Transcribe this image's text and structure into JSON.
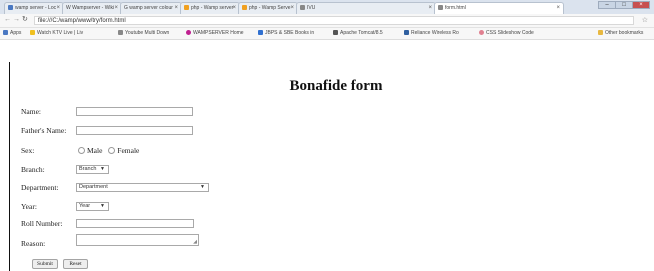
{
  "browser": {
    "tabs": [
      {
        "label": "wamp server - Loc",
        "color": "#4a78c2"
      },
      {
        "label": "W  Wampserver - Wiki",
        "color": "#555555"
      },
      {
        "label": "G  wamp server colour",
        "color": "#4a78c2"
      },
      {
        "label": "php - Wamp server",
        "color": "#f0a020"
      },
      {
        "label": "php - Wamp Serve",
        "color": "#f0a020"
      },
      {
        "label": "IVU",
        "color": "#888888"
      },
      {
        "label": "form.html",
        "color": "#888888"
      }
    ],
    "window_buttons": {
      "minimize": "–",
      "maximize": "□",
      "close": "×"
    },
    "url": "file:///C:/wamp/www/try/form.html",
    "bookmarks": [
      {
        "label": "Apps",
        "color": "#4a78c2"
      },
      {
        "label": "Watch KTV Live | Liv",
        "color": "#f0c020"
      },
      {
        "label": "Youtube Multi Down",
        "color": "#888888"
      },
      {
        "label": "WAMPSERVER Home",
        "color": "#c02090"
      },
      {
        "label": "JBPS & SBE Books in",
        "color": "#3070d0"
      },
      {
        "label": "Apache Tomcat/8.5",
        "color": "#555555"
      },
      {
        "label": "Reliance Wireless Ro",
        "color": "#3060a0"
      },
      {
        "label": "CSS Slideshow Code",
        "color": "#e08090"
      },
      {
        "label": "Other bookmarks",
        "color": "#e8b840"
      }
    ]
  },
  "form": {
    "title": "Bonafide form",
    "labels": {
      "name": "Name:",
      "father": "Father's Name:",
      "sex": "Sex:",
      "branch": "Branch:",
      "department": "Department:",
      "year": "Year:",
      "roll": "Roll Number:",
      "reason": "Reason:"
    },
    "sex_options": {
      "male": "Male",
      "female": "Female"
    },
    "branch_select": "Branch",
    "department_select": "Department",
    "year_select": "Year",
    "submit": "Submit",
    "reset": "Reset"
  }
}
